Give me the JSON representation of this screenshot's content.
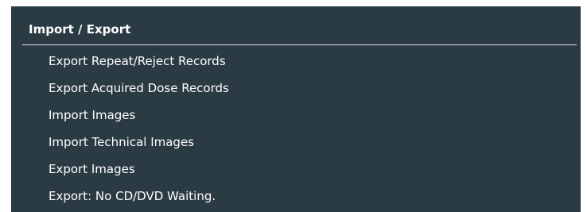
{
  "section": {
    "title": "Import / Export",
    "items": [
      {
        "label": "Export Repeat/Reject Records"
      },
      {
        "label": "Export Acquired Dose Records"
      },
      {
        "label": "Import Images"
      },
      {
        "label": "Import Technical Images"
      },
      {
        "label": "Export Images"
      },
      {
        "label": "Export: No CD/DVD Waiting."
      }
    ]
  },
  "colors": {
    "panel_background": "#2b3b43",
    "text": "#ffffff",
    "divider": "#d8dde0"
  }
}
